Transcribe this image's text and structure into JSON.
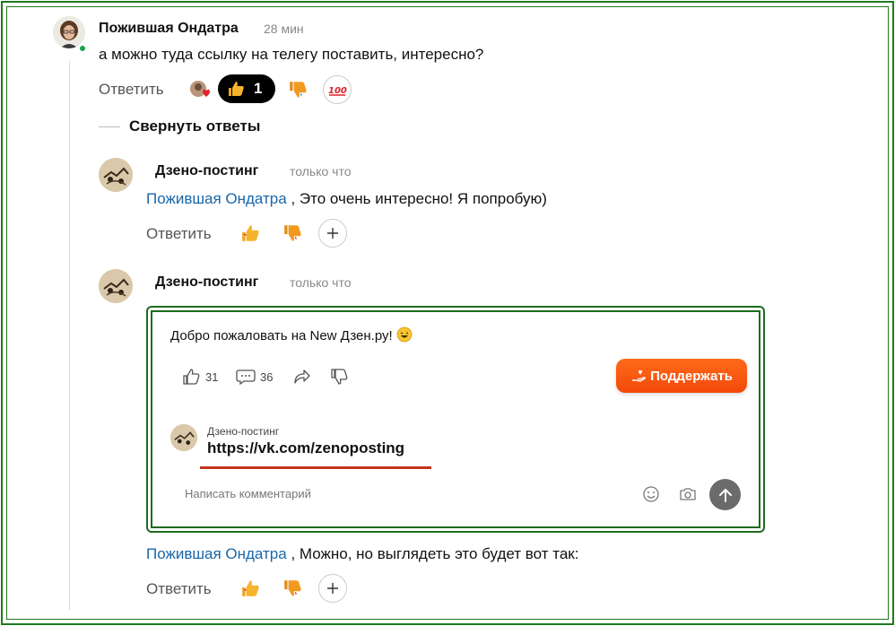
{
  "comment_main": {
    "author": "Пожившая Ондатра",
    "time": "28 мин",
    "text": "а можно туда ссылку на телегу поставить, интересно?",
    "reply_label": "Ответить",
    "like_count": "1"
  },
  "collapse_label": "Свернуть ответы",
  "reply1": {
    "author": "Дзено-постинг",
    "time": "только что",
    "mention": "Пожившая Ондатра",
    "text": " , Это очень интересно! Я попробую)",
    "reply_label": "Ответить"
  },
  "reply2": {
    "author": "Дзено-постинг",
    "time": "только что",
    "embed": {
      "post_text": "Добро пожаловать на New Дзен.ру!",
      "likes": "31",
      "comments": "36",
      "support_label": "Поддержать",
      "comment_author": "Дзено-постинг",
      "comment_link": "https://vk.com/zenoposting",
      "input_placeholder": "Написать комментарий"
    },
    "mention": "Пожившая Ондатра",
    "text": " , Можно, но выглядеть это будет вот так:",
    "reply_label": "Ответить"
  },
  "colors": {
    "frame": "#1e7a1e",
    "mention": "#1866a8",
    "support_button": "#f2490a",
    "underline": "#c0361a"
  }
}
